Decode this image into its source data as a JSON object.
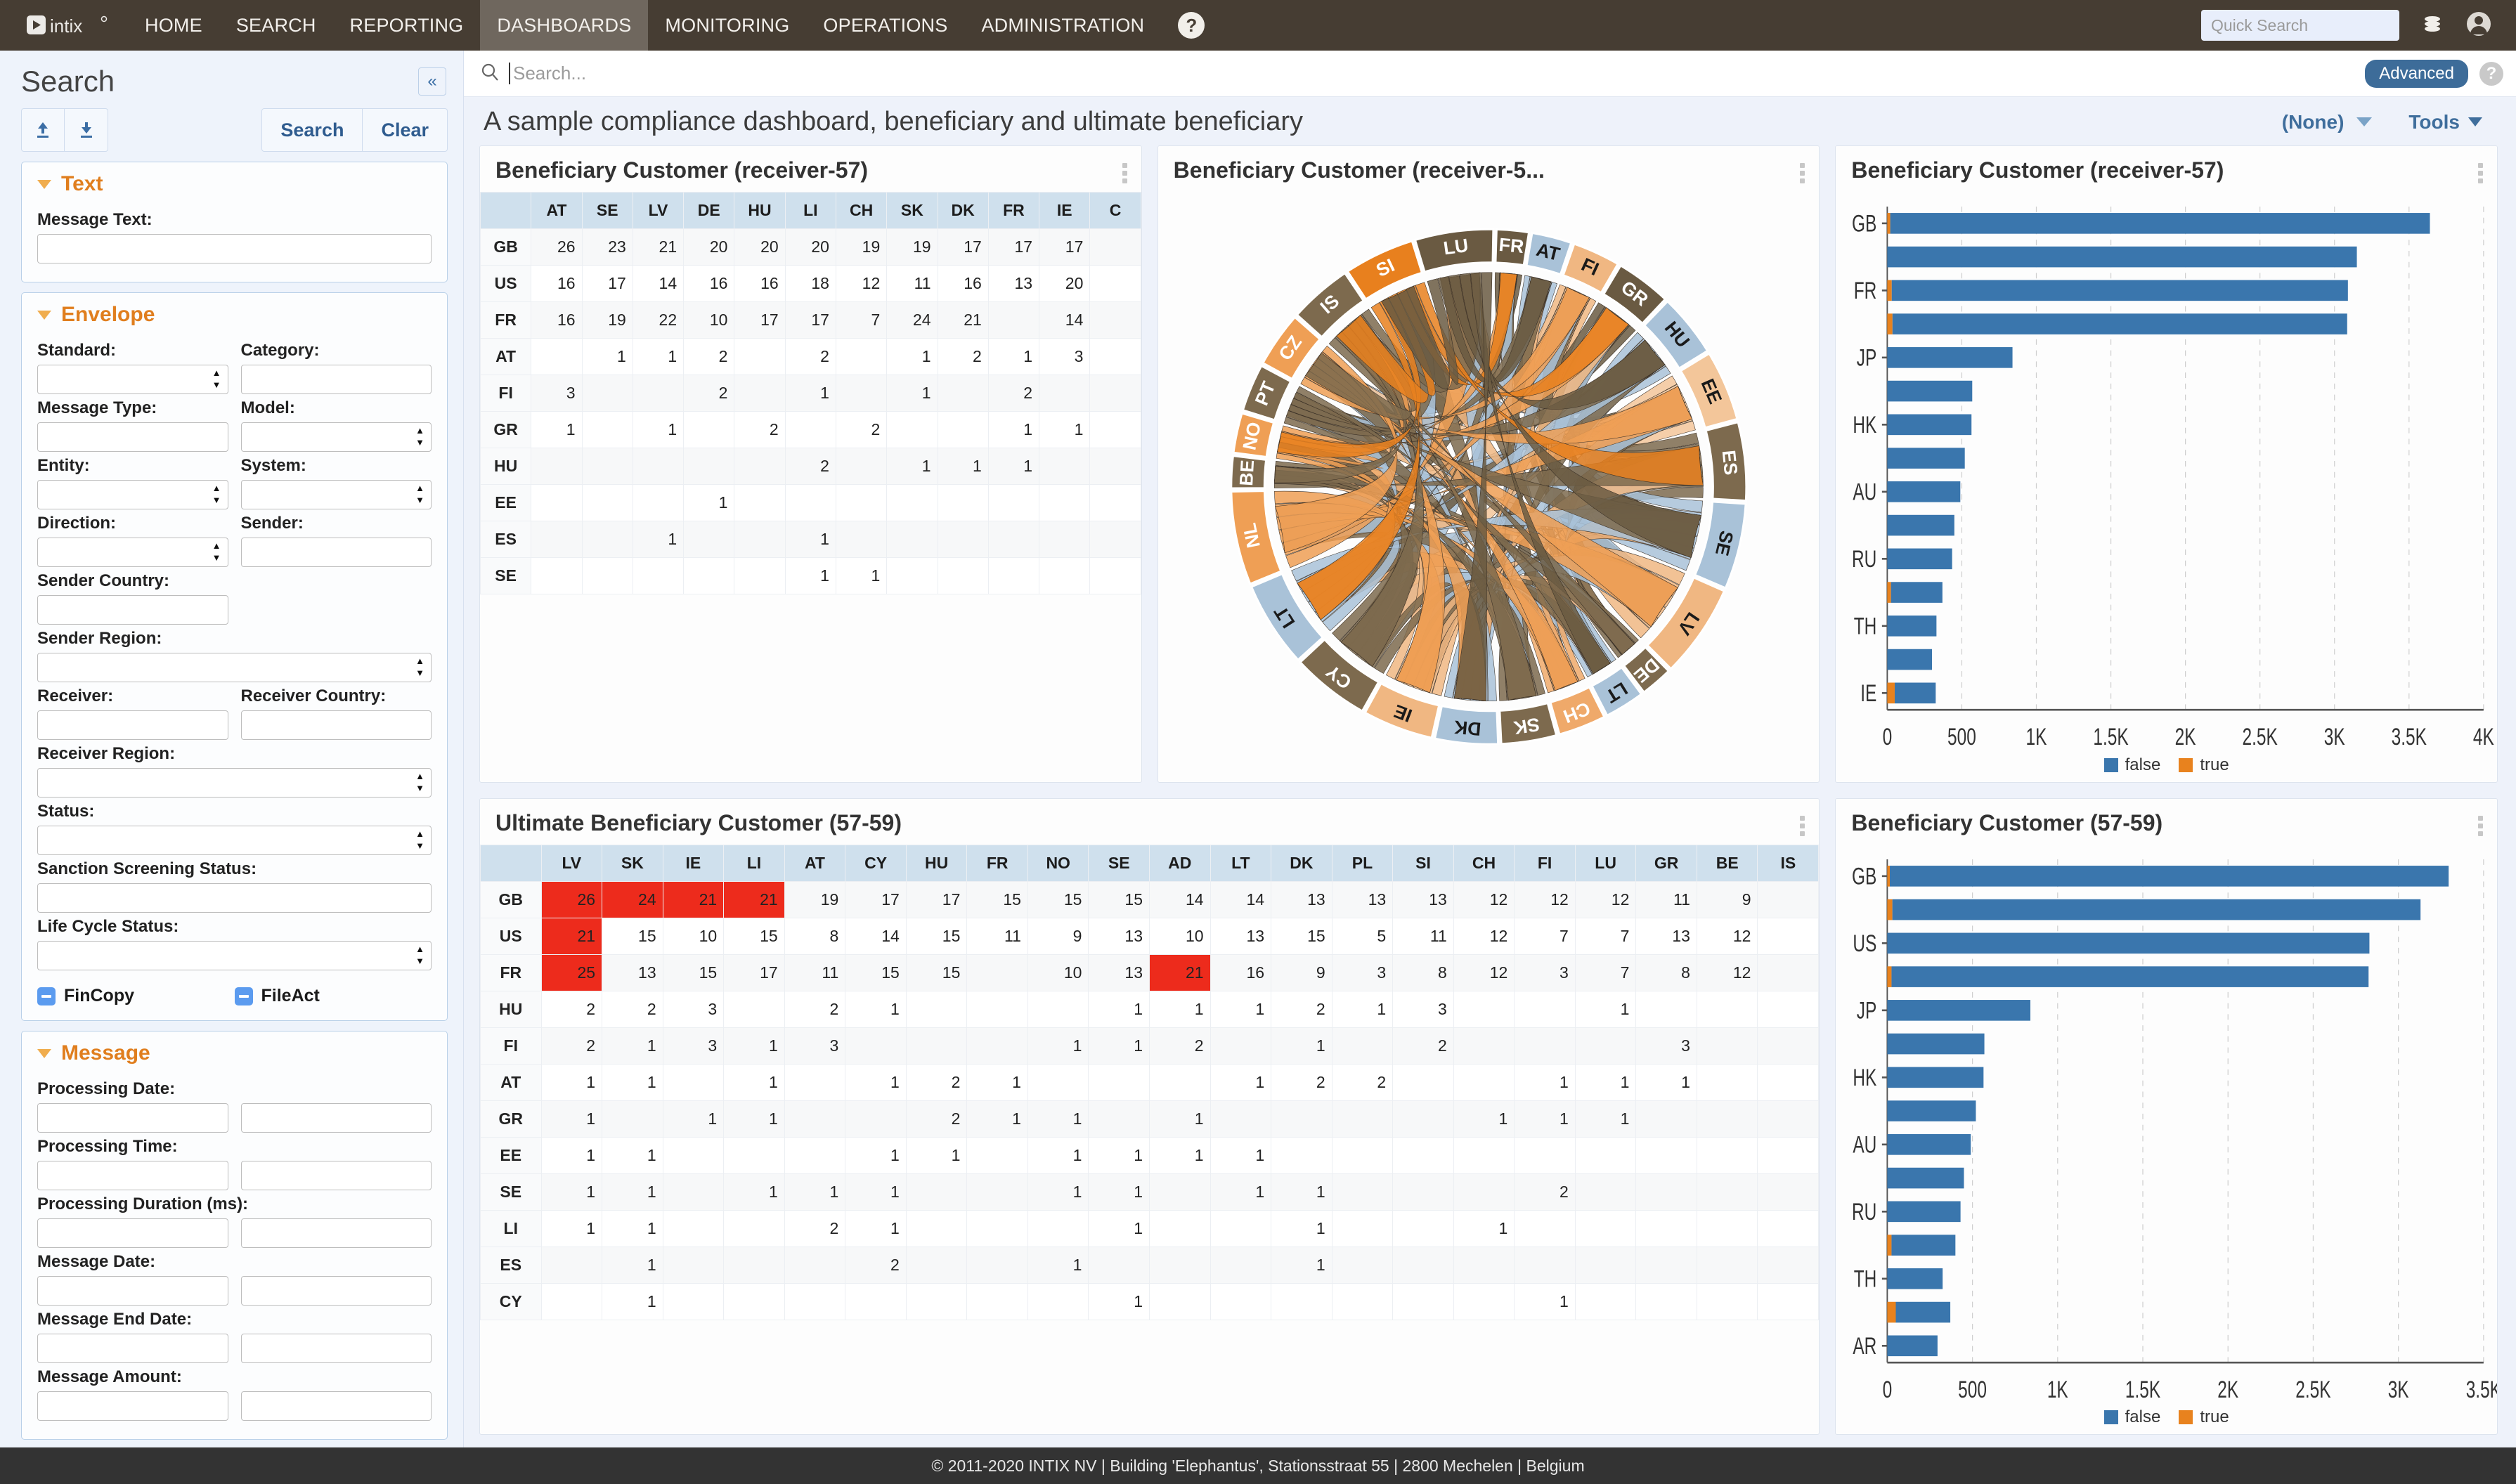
{
  "topnav": {
    "brand": "intix",
    "items": [
      {
        "label": "HOME",
        "active": false
      },
      {
        "label": "SEARCH",
        "active": false
      },
      {
        "label": "REPORTING",
        "active": false
      },
      {
        "label": "DASHBOARDS",
        "active": true
      },
      {
        "label": "MONITORING",
        "active": false
      },
      {
        "label": "OPERATIONS",
        "active": false
      },
      {
        "label": "ADMINISTRATION",
        "active": false
      }
    ],
    "help_label": "?",
    "quick_search_placeholder": "Quick Search",
    "quick_search_value": ""
  },
  "sidebar": {
    "title": "Search",
    "collapse_label": "«",
    "search_button": "Search",
    "clear_button": "Clear",
    "panels": [
      {
        "name": "Text",
        "fields": [
          {
            "label": "Message Text:",
            "type": "text",
            "value": "",
            "full": true
          }
        ]
      },
      {
        "name": "Envelope",
        "fields": [
          {
            "label": "Standard:",
            "type": "select",
            "value": ""
          },
          {
            "label": "Category:",
            "type": "text",
            "value": ""
          },
          {
            "label": "Message Type:",
            "type": "text",
            "value": ""
          },
          {
            "label": "Model:",
            "type": "select",
            "value": ""
          },
          {
            "label": "Entity:",
            "type": "select",
            "value": ""
          },
          {
            "label": "System:",
            "type": "select",
            "value": ""
          },
          {
            "label": "Direction:",
            "type": "select",
            "value": ""
          },
          {
            "label": "Sender:",
            "type": "text",
            "value": ""
          },
          {
            "label": "Sender Country:",
            "type": "text",
            "value": "",
            "half": true
          },
          {
            "label": "Sender Region:",
            "type": "select",
            "value": "",
            "full": true
          },
          {
            "label": "Receiver:",
            "type": "text",
            "value": ""
          },
          {
            "label": "Receiver Country:",
            "type": "text",
            "value": ""
          },
          {
            "label": "Receiver Region:",
            "type": "select",
            "value": "",
            "full": true
          },
          {
            "label": "Status:",
            "type": "select",
            "value": "",
            "full": true
          },
          {
            "label": "Sanction Screening Status:",
            "type": "text",
            "value": "",
            "full": true
          },
          {
            "label": "Life Cycle Status:",
            "type": "select",
            "value": "",
            "full": true
          }
        ],
        "checkboxes": [
          {
            "label": "FinCopy",
            "state": "indeterminate"
          },
          {
            "label": "FileAct",
            "state": "indeterminate"
          }
        ]
      },
      {
        "name": "Message",
        "fields": [
          {
            "label": "Processing Date:",
            "type": "pair"
          },
          {
            "label": "Processing Time:",
            "type": "pair"
          },
          {
            "label": "Processing Duration (ms):",
            "type": "pair"
          },
          {
            "label": "Message Date:",
            "type": "pair"
          },
          {
            "label": "Message End Date:",
            "type": "pair"
          },
          {
            "label": "Message Amount:",
            "type": "pair"
          }
        ]
      }
    ]
  },
  "main": {
    "search_placeholder": "Search...",
    "search_value": "",
    "advanced_label": "Advanced",
    "help_label": "?",
    "dashboard_title": "A sample compliance dashboard, beneficiary and ultimate beneficiary",
    "dashboard_selector": "(None)",
    "tools_label": "Tools"
  },
  "widgets": {
    "table1_title": "Beneficiary Customer (receiver-57)",
    "chord_title": "Beneficiary Customer (receiver-5...",
    "bar1_title": "Beneficiary Customer (receiver-57)",
    "table2_title": "Ultimate Beneficiary Customer (57-59)",
    "bar2_title": "Beneficiary Customer (57-59)"
  },
  "chart_data": [
    {
      "type": "table",
      "title": "Beneficiary Customer (receiver-57)",
      "columns": [
        "AT",
        "SE",
        "LV",
        "DE",
        "HU",
        "LI",
        "CH",
        "SK",
        "DK",
        "FR",
        "IE",
        "C"
      ],
      "rows": [
        {
          "label": "GB",
          "values": [
            26,
            23,
            21,
            20,
            20,
            20,
            19,
            19,
            17,
            17,
            17,
            null
          ]
        },
        {
          "label": "US",
          "values": [
            16,
            17,
            14,
            16,
            16,
            18,
            12,
            11,
            16,
            13,
            20,
            null
          ]
        },
        {
          "label": "FR",
          "values": [
            16,
            19,
            22,
            10,
            17,
            17,
            7,
            24,
            21,
            null,
            14,
            null
          ]
        },
        {
          "label": "AT",
          "values": [
            null,
            1,
            1,
            2,
            null,
            2,
            null,
            1,
            2,
            1,
            3,
            null
          ]
        },
        {
          "label": "FI",
          "values": [
            3,
            null,
            null,
            2,
            null,
            1,
            null,
            1,
            null,
            2,
            null,
            null
          ]
        },
        {
          "label": "GR",
          "values": [
            1,
            null,
            1,
            null,
            2,
            null,
            2,
            null,
            null,
            1,
            1,
            null
          ]
        },
        {
          "label": "HU",
          "values": [
            null,
            null,
            null,
            null,
            null,
            2,
            null,
            1,
            1,
            1,
            null,
            null
          ]
        },
        {
          "label": "EE",
          "values": [
            null,
            null,
            null,
            1,
            null,
            null,
            null,
            null,
            null,
            null,
            null,
            null
          ]
        },
        {
          "label": "ES",
          "values": [
            null,
            null,
            1,
            null,
            null,
            1,
            null,
            null,
            null,
            null,
            null,
            null
          ]
        },
        {
          "label": "SE",
          "values": [
            null,
            null,
            null,
            null,
            null,
            1,
            1,
            null,
            null,
            null,
            null,
            null
          ]
        }
      ]
    },
    {
      "type": "chord",
      "title": "Beneficiary Customer (receiver-5...",
      "nodes": [
        "FR",
        "AT",
        "FI",
        "GR",
        "HU",
        "EE",
        "ES",
        "SE",
        "LV",
        "DE",
        "LT",
        "CH",
        "SK",
        "DK",
        "IE",
        "CY",
        "LT",
        "NL",
        "BE",
        "NO",
        "PT",
        "CZ",
        "IS",
        "SI",
        "LU"
      ]
    },
    {
      "type": "bar",
      "orientation": "horizontal",
      "stacked": true,
      "title": "Beneficiary Customer (receiver-57)",
      "categories": [
        "GB",
        "",
        "FR",
        "",
        "JP",
        "",
        "HK",
        "",
        "AU",
        "",
        "RU",
        "",
        "TH",
        "",
        "IE"
      ],
      "tick_labels": [
        "GB",
        "FR",
        "JP",
        "HK",
        "AU",
        "RU",
        "TH",
        "IE"
      ],
      "series": [
        {
          "name": "false",
          "color": "#3a76ad",
          "values": [
            3620,
            3150,
            3060,
            3050,
            840,
            570,
            565,
            520,
            490,
            450,
            435,
            345,
            330,
            300,
            275
          ]
        },
        {
          "name": "true",
          "color": "#e8821e",
          "values": [
            20,
            0,
            30,
            35,
            0,
            0,
            0,
            0,
            0,
            0,
            0,
            25,
            0,
            0,
            50
          ]
        }
      ],
      "xlabel": "",
      "ylabel": "",
      "xticks": [
        0,
        500,
        1000,
        1500,
        2000,
        2500,
        3000,
        3500,
        4000
      ],
      "xticklabels": [
        "0",
        "500",
        "1K",
        "1.5K",
        "2K",
        "2.5K",
        "3K",
        "3.5K",
        "4K"
      ],
      "xlim": [
        0,
        4000
      ],
      "legend": [
        "false",
        "true"
      ],
      "legend_position": "bottom",
      "grid": true
    },
    {
      "type": "table",
      "title": "Ultimate Beneficiary Customer (57-59)",
      "columns": [
        "LV",
        "SK",
        "IE",
        "LI",
        "AT",
        "CY",
        "HU",
        "FR",
        "NO",
        "SE",
        "AD",
        "LT",
        "DK",
        "PL",
        "SI",
        "CH",
        "FI",
        "LU",
        "GR",
        "BE",
        "IS"
      ],
      "rows": [
        {
          "label": "GB",
          "values": [
            26,
            24,
            21,
            21,
            19,
            17,
            17,
            15,
            15,
            15,
            14,
            14,
            13,
            13,
            13,
            12,
            12,
            12,
            11,
            9,
            null
          ],
          "hot": [
            0,
            1,
            2,
            3
          ],
          "lo": [
            19
          ]
        },
        {
          "label": "US",
          "values": [
            21,
            15,
            10,
            15,
            8,
            14,
            15,
            11,
            9,
            13,
            10,
            13,
            15,
            5,
            11,
            12,
            7,
            7,
            13,
            12,
            null
          ],
          "hot": [
            0
          ],
          "lo": [
            4,
            8,
            13,
            16,
            17
          ]
        },
        {
          "label": "FR",
          "values": [
            25,
            13,
            15,
            17,
            11,
            15,
            15,
            null,
            10,
            13,
            21,
            16,
            9,
            3,
            8,
            12,
            3,
            7,
            8,
            12,
            null
          ],
          "hot": [
            0,
            10
          ],
          "lo": [
            12,
            13,
            14,
            16,
            17,
            18
          ]
        },
        {
          "label": "HU",
          "values": [
            2,
            2,
            3,
            null,
            2,
            1,
            null,
            null,
            null,
            1,
            1,
            1,
            2,
            1,
            3,
            null,
            null,
            1,
            null,
            null,
            null
          ],
          "hot": [],
          "lo": [
            0,
            1,
            2,
            4,
            5,
            9,
            10,
            11,
            12,
            13,
            14,
            17
          ]
        },
        {
          "label": "FI",
          "values": [
            2,
            1,
            3,
            1,
            3,
            null,
            null,
            null,
            1,
            1,
            2,
            null,
            1,
            null,
            2,
            null,
            null,
            null,
            3,
            null,
            null
          ],
          "hot": [],
          "lo": [
            0,
            1,
            2,
            3,
            4,
            8,
            9,
            10,
            12,
            14,
            18
          ]
        },
        {
          "label": "AT",
          "values": [
            1,
            1,
            null,
            1,
            null,
            1,
            2,
            1,
            null,
            null,
            null,
            1,
            2,
            2,
            null,
            null,
            1,
            1,
            1,
            null,
            null
          ],
          "hot": [],
          "lo": [
            0,
            1,
            3,
            5,
            6,
            7,
            11,
            12,
            13,
            16,
            17,
            18
          ]
        },
        {
          "label": "GR",
          "values": [
            1,
            null,
            1,
            1,
            null,
            null,
            2,
            1,
            1,
            null,
            1,
            null,
            null,
            null,
            null,
            1,
            1,
            1,
            null,
            null,
            null
          ],
          "hot": [],
          "lo": [
            0,
            2,
            3,
            6,
            7,
            8,
            10,
            15,
            16,
            17
          ]
        },
        {
          "label": "EE",
          "values": [
            1,
            1,
            null,
            null,
            null,
            1,
            1,
            null,
            1,
            1,
            1,
            1,
            null,
            null,
            null,
            null,
            null,
            null,
            null,
            null,
            null
          ],
          "hot": [],
          "lo": [
            0,
            1,
            5,
            6,
            8,
            9,
            10,
            11
          ]
        },
        {
          "label": "SE",
          "values": [
            1,
            1,
            null,
            1,
            1,
            1,
            null,
            null,
            1,
            1,
            null,
            1,
            1,
            null,
            null,
            null,
            2,
            null,
            null,
            null,
            null
          ],
          "hot": [],
          "lo": [
            0,
            1,
            3,
            4,
            5,
            8,
            9,
            11,
            12,
            16
          ]
        },
        {
          "label": "LI",
          "values": [
            1,
            1,
            null,
            null,
            2,
            1,
            null,
            null,
            null,
            1,
            null,
            null,
            1,
            null,
            null,
            1,
            null,
            null,
            null,
            null,
            null
          ],
          "hot": [],
          "lo": [
            0,
            1,
            4,
            5,
            9,
            12,
            15
          ]
        },
        {
          "label": "ES",
          "values": [
            null,
            1,
            null,
            null,
            null,
            2,
            null,
            null,
            1,
            null,
            null,
            null,
            1,
            null,
            null,
            null,
            null,
            null,
            null,
            null,
            null
          ],
          "hot": [],
          "lo": [
            1,
            5,
            8,
            12
          ]
        },
        {
          "label": "CY",
          "values": [
            null,
            1,
            null,
            null,
            null,
            null,
            null,
            null,
            null,
            1,
            null,
            null,
            null,
            null,
            null,
            null,
            1,
            null,
            null,
            null,
            null
          ],
          "hot": [],
          "lo": [
            1,
            9,
            16
          ]
        }
      ]
    },
    {
      "type": "bar",
      "orientation": "horizontal",
      "stacked": true,
      "title": "Beneficiary Customer (57-59)",
      "categories": [
        "GB",
        "",
        "US",
        "",
        "JP",
        "",
        "HK",
        "",
        "AU",
        "",
        "RU",
        "",
        "TH",
        "",
        "AR"
      ],
      "tick_labels": [
        "GB",
        "US",
        "JP",
        "HK",
        "AU",
        "RU",
        "TH",
        "AR"
      ],
      "series": [
        {
          "name": "false",
          "color": "#3a76ad",
          "values": [
            3280,
            3100,
            2830,
            2800,
            840,
            570,
            565,
            520,
            490,
            450,
            430,
            375,
            325,
            320,
            295
          ]
        },
        {
          "name": "true",
          "color": "#e8821e",
          "values": [
            15,
            30,
            0,
            25,
            0,
            0,
            0,
            0,
            0,
            0,
            0,
            25,
            0,
            50,
            0
          ]
        }
      ],
      "xlabel": "",
      "ylabel": "",
      "xticks": [
        0,
        500,
        1000,
        1500,
        2000,
        2500,
        3000,
        3500
      ],
      "xticklabels": [
        "0",
        "500",
        "1K",
        "1.5K",
        "2K",
        "2.5K",
        "3K",
        "3.5K"
      ],
      "xlim": [
        0,
        3500
      ],
      "legend": [
        "false",
        "true"
      ],
      "legend_position": "bottom",
      "grid": true
    }
  ],
  "footer": {
    "text": "© 2011-2020 INTIX NV | Building 'Elephantus', Stationsstraat 55 | 2800 Mechelen | Belgium"
  }
}
